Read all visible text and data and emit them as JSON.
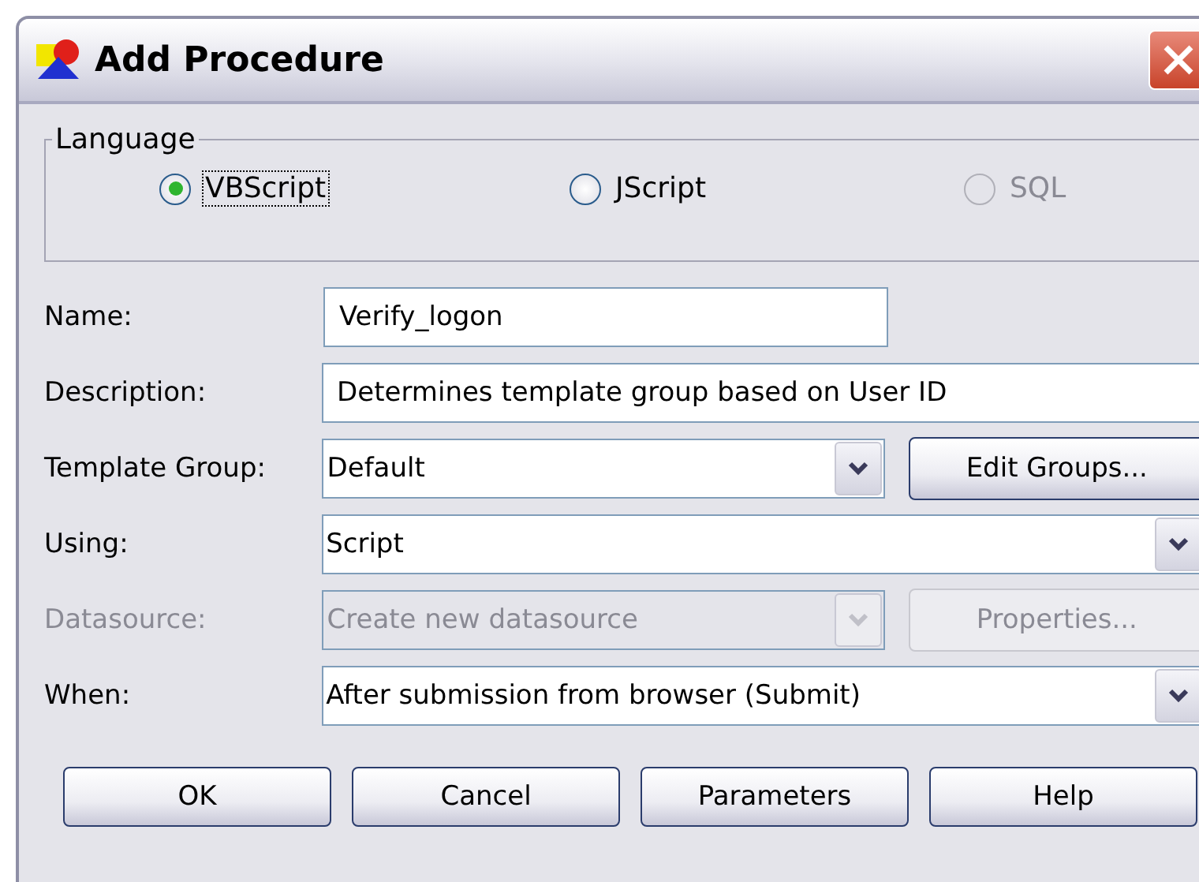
{
  "window": {
    "title": "Add Procedure"
  },
  "language": {
    "label": "Language",
    "options": [
      {
        "label": "VBScript",
        "selected": true,
        "disabled": false,
        "focused": true
      },
      {
        "label": "JScript",
        "selected": false,
        "disabled": false,
        "focused": false
      },
      {
        "label": "SQL",
        "selected": false,
        "disabled": true,
        "focused": false
      }
    ]
  },
  "fields": [
    {
      "kind": "short-text",
      "label": "Name:",
      "value": "Verify_logon",
      "disabled": false
    },
    {
      "kind": "text",
      "label": "Description:",
      "value": "Determines template group based on User ID",
      "disabled": false
    },
    {
      "kind": "combo",
      "label": "Template Group:",
      "value": "Default",
      "disabled": false,
      "button": {
        "label": "Edit Groups...",
        "disabled": false
      }
    },
    {
      "kind": "combo",
      "label": "Using:",
      "value": "Script",
      "disabled": false
    },
    {
      "kind": "combo",
      "label": "Datasource:",
      "value": "Create new datasource",
      "disabled": true,
      "button": {
        "label": "Properties...",
        "disabled": true
      }
    },
    {
      "kind": "combo",
      "label": "When:",
      "value": "After submission from browser (Submit)",
      "disabled": false
    }
  ],
  "buttons": [
    "OK",
    "Cancel",
    "Parameters",
    "Help"
  ]
}
